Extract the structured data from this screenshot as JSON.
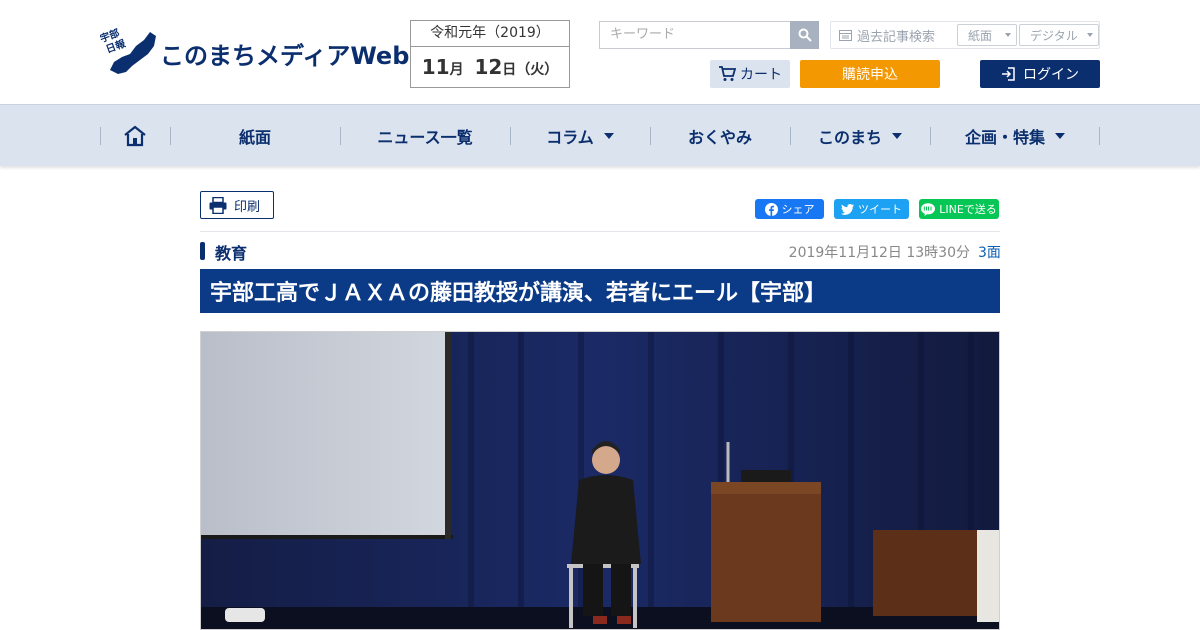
{
  "header": {
    "logo_text": "このまちメディアWeb",
    "logo_badge_top": "宇部",
    "logo_badge_bottom": "日報",
    "date": {
      "era": "令和元年（2019）",
      "month": "11",
      "month_unit": "月",
      "day": "12",
      "day_unit": "日",
      "weekday": "（火）"
    },
    "search": {
      "placeholder": "キーワード",
      "button_icon": "search-icon"
    },
    "archive": {
      "label": "過去記事検索",
      "select_paper": "紙面",
      "select_digital": "デジタル"
    },
    "cart_label": "カート",
    "subscribe_label": "購読申込",
    "login_label": "ログイン"
  },
  "nav": {
    "home_icon": "home-icon",
    "items": [
      {
        "label": "紙面",
        "dropdown": false
      },
      {
        "label": "ニュース一覧",
        "dropdown": false
      },
      {
        "label": "コラム",
        "dropdown": true
      },
      {
        "label": "おくやみ",
        "dropdown": false
      },
      {
        "label": "このまち",
        "dropdown": true
      },
      {
        "label": "企画・特集",
        "dropdown": true
      }
    ]
  },
  "article": {
    "print_label": "印刷",
    "share": {
      "facebook": "シェア",
      "twitter": "ツイート",
      "line": "LINEで送る"
    },
    "category": "教育",
    "date": "2019年11月12日 13時30分",
    "page": "3面",
    "title": "宇部工高でＪＡＸＡの藤田教授が講演、若者にエール【宇部】"
  },
  "colors": {
    "brand_navy": "#0b2f6e",
    "title_bg": "#0b3a86",
    "nav_bg": "#dbe3ee",
    "subscribe_orange": "#f39800",
    "facebook": "#1877f2",
    "twitter": "#1da1f2",
    "line": "#06c755"
  }
}
